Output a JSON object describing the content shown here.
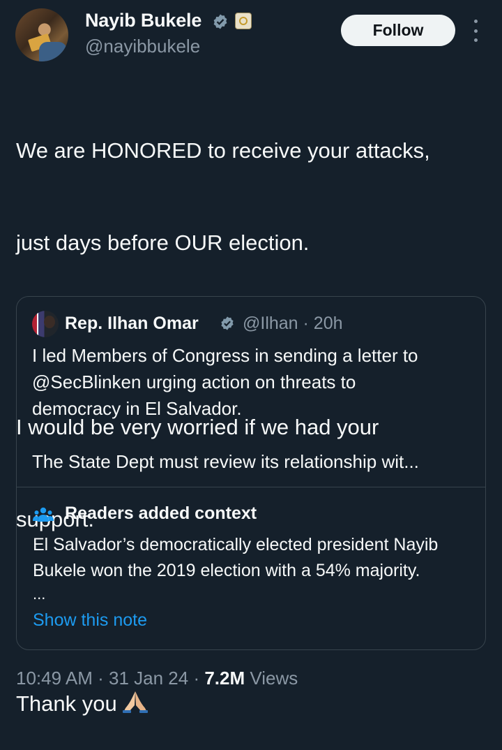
{
  "author": {
    "name": "Nayib Bukele",
    "handle": "@nayibbukele"
  },
  "follow_label": "Follow",
  "tweet_lines": [
    "We are HONORED to receive your attacks,",
    "just days before OUR election.",
    "",
    "I would be very worried if we had your",
    "support.",
    "",
    "Thank you"
  ],
  "quoted": {
    "name": "Rep. Ilhan Omar",
    "meta": "@Ilhan · 20h",
    "lines": [
      "I led Members of Congress in sending a letter to",
      "@SecBlinken urging action on threats to",
      "democracy in El Salvador.",
      "",
      "The State Dept must review its relationship wit..."
    ]
  },
  "context": {
    "title": "Readers added context",
    "lines": [
      "El Salvador’s democratically elected president Nayib",
      "Bukele won the 2019 election with a 54% majority."
    ],
    "ellipsis": "...",
    "show_note": "Show this note"
  },
  "footer": {
    "time": "10:49 AM",
    "date": "31 Jan 24",
    "views_count": "7.2M",
    "views_label": "Views"
  },
  "colors": {
    "background": "#15202b",
    "text": "#f7f9f9",
    "secondary": "#8b98a5",
    "link": "#1d9bf0",
    "verified": "#829aab"
  }
}
